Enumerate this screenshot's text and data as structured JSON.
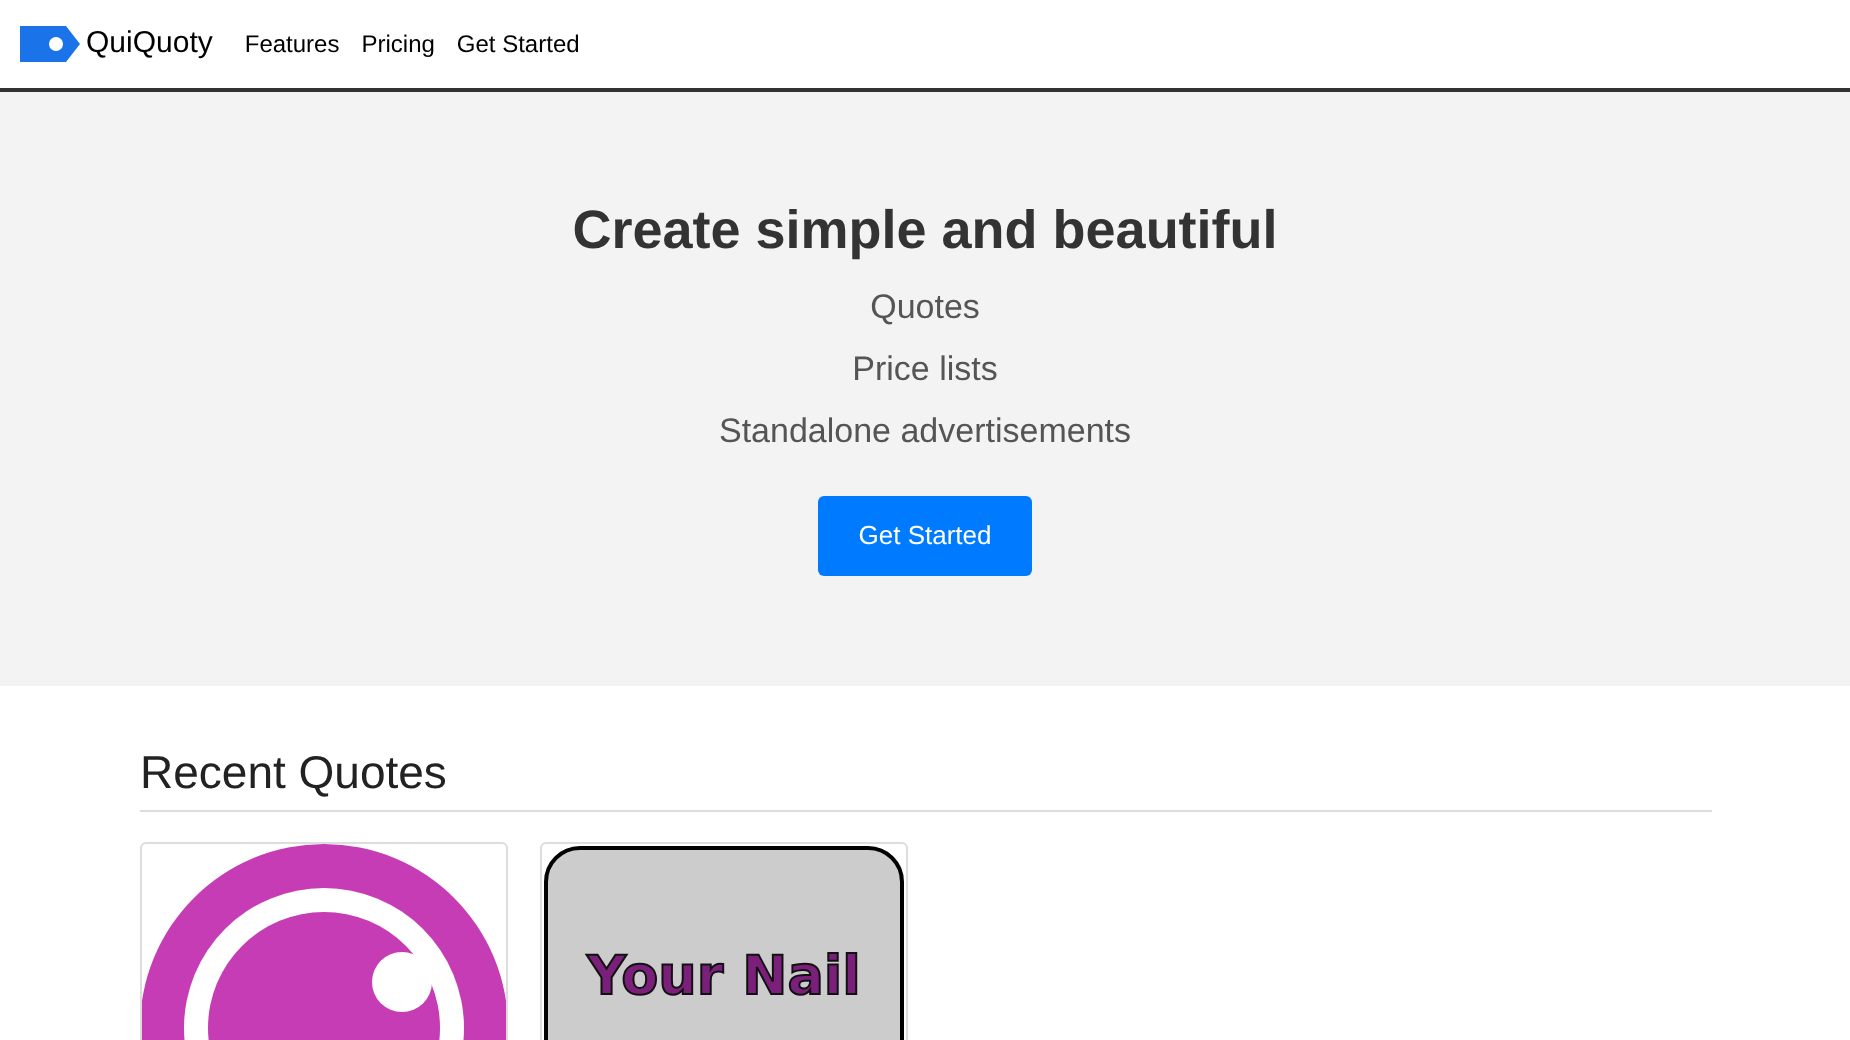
{
  "navbar": {
    "brand": "QuiQuoty",
    "links": [
      {
        "label": "Features"
      },
      {
        "label": "Pricing"
      },
      {
        "label": "Get Started"
      }
    ]
  },
  "hero": {
    "title": "Create simple and beautiful",
    "items": [
      "Quotes",
      "Price lists",
      "Standalone advertisements"
    ],
    "button": "Get Started"
  },
  "recent": {
    "heading": "Recent Quotes",
    "cards": [
      {
        "kind": "logo"
      },
      {
        "kind": "text",
        "text": "Your Nail"
      }
    ]
  }
}
